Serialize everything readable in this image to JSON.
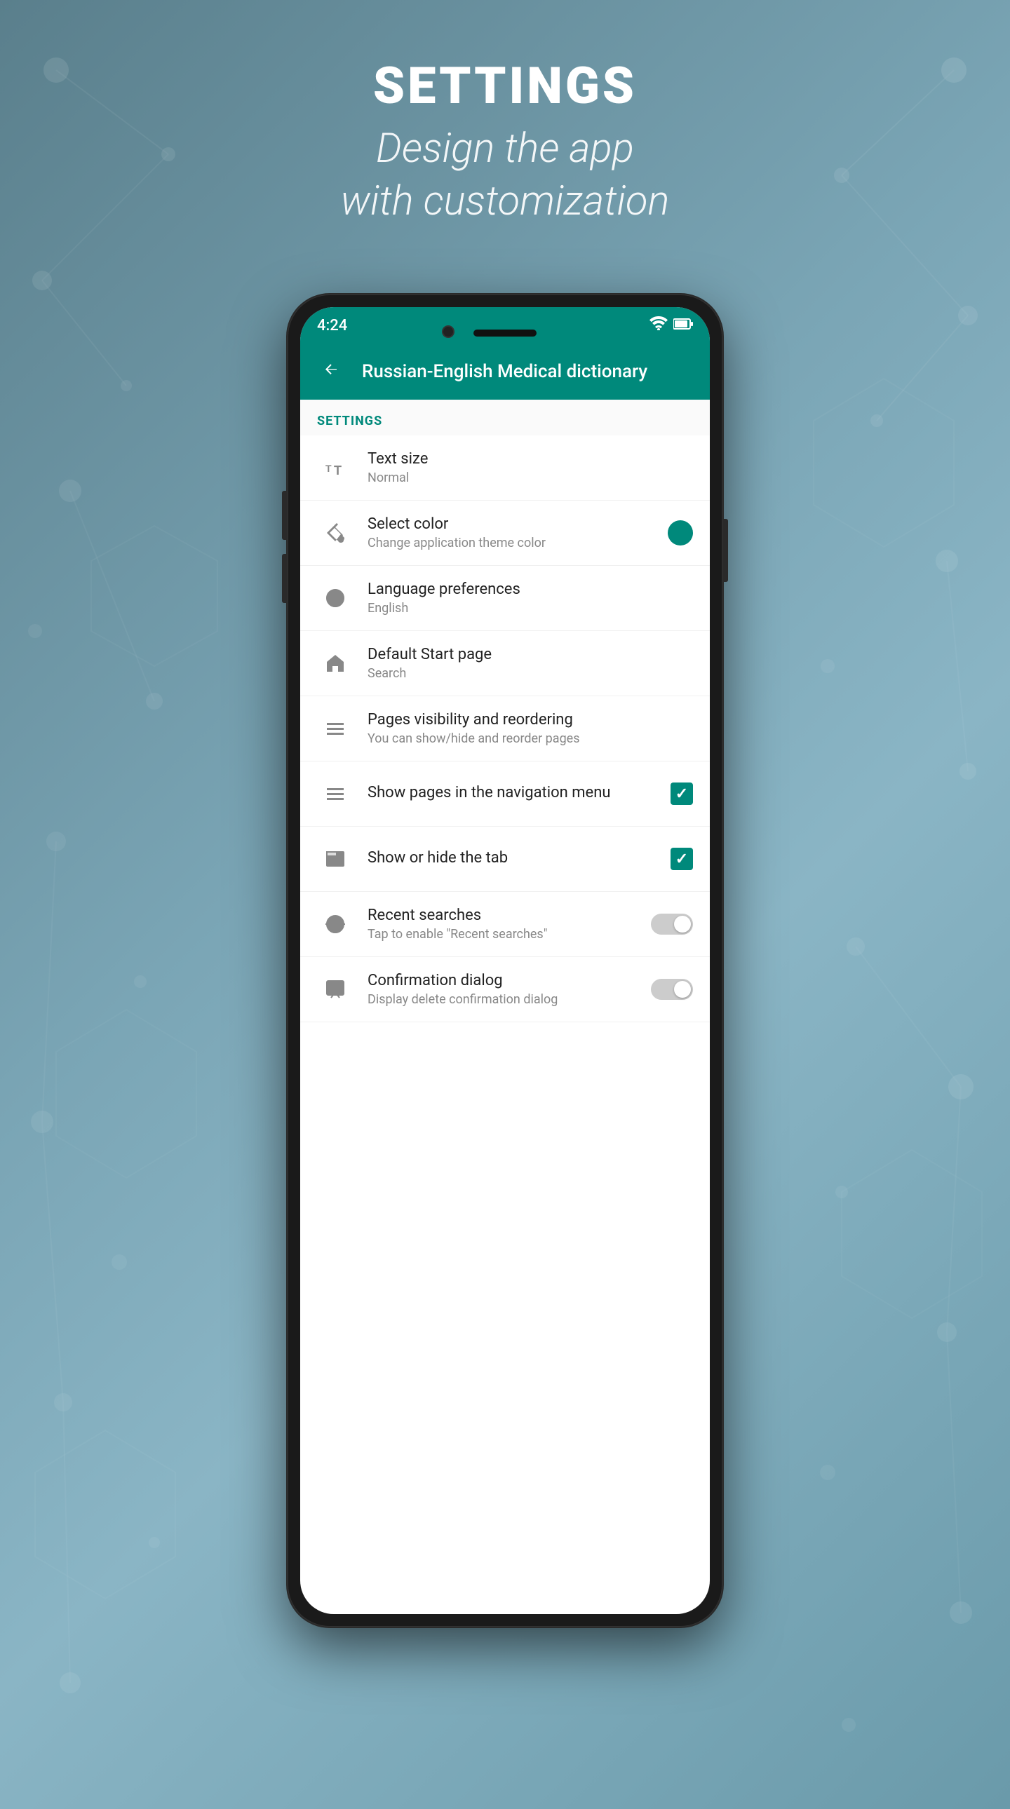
{
  "background": {
    "gradient_start": "#5a7f8c",
    "gradient_end": "#6a9aaa"
  },
  "header": {
    "title": "SETTINGS",
    "subtitle_line1": "Design the app",
    "subtitle_line2": "with customization"
  },
  "status_bar": {
    "time": "4:24",
    "wifi_icon": "wifi",
    "battery_icon": "battery"
  },
  "app_bar": {
    "back_label": "←",
    "title": "Russian-English Medical dictionary"
  },
  "settings_section": {
    "header": "SETTINGS",
    "items": [
      {
        "icon": "text-size",
        "title": "Text size",
        "subtitle": "Normal",
        "control": "none"
      },
      {
        "icon": "paint-bucket",
        "title": "Select color",
        "subtitle": "Change application theme color",
        "control": "color-dot"
      },
      {
        "icon": "globe",
        "title": "Language preferences",
        "subtitle": "English",
        "control": "none"
      },
      {
        "icon": "home",
        "title": "Default Start page",
        "subtitle": "Search",
        "control": "none"
      },
      {
        "icon": "list",
        "title": "Pages visibility and reordering",
        "subtitle": "You can show/hide and reorder pages",
        "control": "none"
      },
      {
        "icon": "menu",
        "title": "Show pages in the navigation menu",
        "subtitle": "",
        "control": "checkbox-checked"
      },
      {
        "icon": "tab",
        "title": "Show or hide the tab",
        "subtitle": "",
        "control": "checkbox-checked"
      },
      {
        "icon": "history",
        "title": "Recent searches",
        "subtitle": "Tap to enable \"Recent searches\"",
        "control": "toggle-off"
      },
      {
        "icon": "dialog",
        "title": "Confirmation dialog",
        "subtitle": "Display delete confirmation dialog",
        "control": "toggle-off"
      }
    ]
  }
}
